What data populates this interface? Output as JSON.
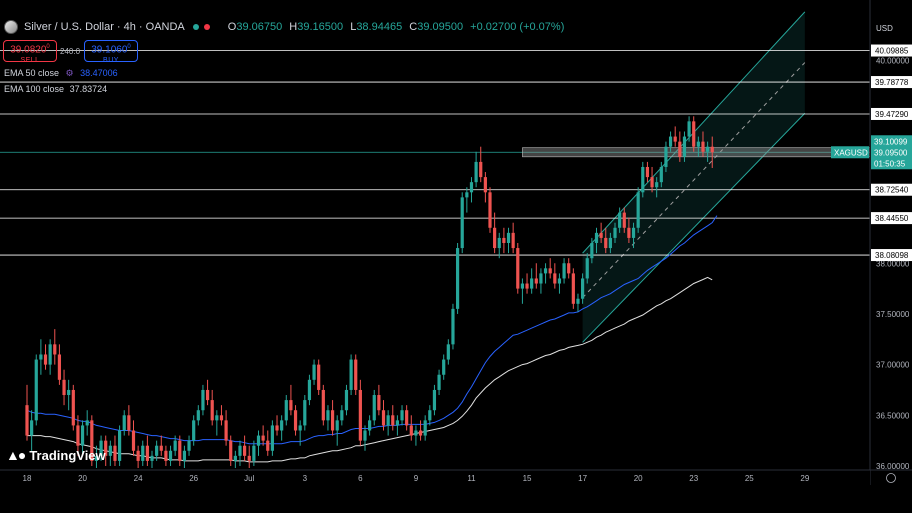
{
  "header": {
    "symbol": "Silver / U.S. Dollar · 4h · OANDA",
    "open_label": "O",
    "open": "39.06750",
    "high_label": "H",
    "high": "39.16500",
    "low_label": "L",
    "low": "38.94465",
    "close_label": "C",
    "close": "39.09500",
    "change": "+0.02700 (+0.07%)",
    "status_colors": [
      "#26a69a",
      "#f23645"
    ]
  },
  "trade": {
    "sell_price": "39.0820",
    "sell_sup": "0",
    "sell_label": "SELL",
    "spread": "240.0",
    "buy_price": "39.1060",
    "buy_sup": "0",
    "buy_label": "BUY"
  },
  "indicators": {
    "ema50_label": "EMA 50 close",
    "ema50_value": "38.47006",
    "ema50_color": "#2962ff",
    "ema100_label": "EMA 100 close",
    "ema100_value": "37.83724",
    "ema100_color": "#e0e0e0"
  },
  "currency": "USD",
  "logo": "TradingView",
  "chart_data": {
    "type": "candlestick",
    "symbol": "XAGUSD",
    "timeframe": "4h",
    "ylim": [
      35.98,
      40.4
    ],
    "y_ticks": [
      36.0,
      36.5,
      37.0,
      37.5,
      38.0,
      40.0
    ],
    "y_tick_labels": [
      "36.00000",
      "36.50000",
      "37.00000",
      "37.50000",
      "38.00000",
      "40.00000"
    ],
    "x_tick_labels": [
      "18",
      "20",
      "24",
      "26",
      "Jul",
      "3",
      "6",
      "9",
      "11",
      "15",
      "17",
      "20",
      "23",
      "25",
      "29"
    ],
    "x_tick_positions": [
      0,
      12,
      24,
      36,
      48,
      60,
      72,
      84,
      96,
      108,
      120,
      132,
      144,
      156,
      168
    ],
    "horizontal_levels": [
      {
        "price": 40.09885,
        "label": "40.09885"
      },
      {
        "price": 39.78778,
        "label": "39.78778"
      },
      {
        "price": 39.4729,
        "label": "39.47290"
      },
      {
        "price": 38.7254,
        "label": "38.72540"
      },
      {
        "price": 38.4455,
        "label": "38.44550"
      },
      {
        "price": 38.08098,
        "label": "38.08098"
      }
    ],
    "price_labels": [
      {
        "label": "39.10099",
        "price": 39.10099
      },
      {
        "label": "XAGUSD",
        "price": 39.095
      },
      {
        "label": "39.09500",
        "price": 39.095
      },
      {
        "label": "01:50:35",
        "price": 39.095
      }
    ],
    "current_price": 39.095,
    "resistance_zone": [
      39.05,
      39.14
    ],
    "channel": {
      "start_bar": 120,
      "end_bar": 168,
      "lower": [
        37.22,
        39.48
      ],
      "upper": [
        38.1,
        40.48
      ],
      "mid": [
        37.66,
        39.98
      ]
    },
    "colors": {
      "up": "#26a69a",
      "down": "#ef5350",
      "ema50": "#2962ff",
      "ema100": "#e0e0e0",
      "channel": "#26a69a"
    },
    "candles": [
      [
        36.6,
        36.8,
        36.25,
        36.3
      ],
      [
        36.3,
        36.55,
        36.15,
        36.45
      ],
      [
        36.45,
        37.1,
        36.4,
        37.05
      ],
      [
        37.05,
        37.25,
        36.9,
        37.1
      ],
      [
        37.1,
        37.2,
        36.95,
        37.0
      ],
      [
        37.0,
        37.25,
        36.9,
        37.2
      ],
      [
        37.2,
        37.35,
        37.0,
        37.1
      ],
      [
        37.1,
        37.2,
        36.8,
        36.85
      ],
      [
        36.85,
        36.95,
        36.6,
        36.7
      ],
      [
        36.7,
        36.85,
        36.55,
        36.75
      ],
      [
        36.75,
        36.8,
        36.35,
        36.4
      ],
      [
        36.4,
        36.5,
        36.1,
        36.2
      ],
      [
        36.2,
        36.45,
        36.1,
        36.4
      ],
      [
        36.4,
        36.55,
        36.3,
        36.45
      ],
      [
        36.45,
        36.5,
        36.0,
        36.05
      ],
      [
        36.05,
        36.2,
        35.98,
        36.1
      ],
      [
        36.1,
        36.3,
        36.05,
        36.25
      ],
      [
        36.25,
        36.3,
        36.0,
        36.1
      ],
      [
        36.1,
        36.25,
        36.0,
        36.2
      ],
      [
        36.2,
        36.3,
        36.0,
        36.05
      ],
      [
        36.05,
        36.4,
        36.0,
        36.35
      ],
      [
        36.35,
        36.55,
        36.3,
        36.5
      ],
      [
        36.5,
        36.6,
        36.3,
        36.35
      ],
      [
        36.35,
        36.45,
        36.1,
        36.15
      ],
      [
        36.15,
        36.2,
        35.98,
        36.05
      ],
      [
        36.05,
        36.25,
        36.0,
        36.2
      ],
      [
        36.2,
        36.3,
        36.0,
        36.05
      ],
      [
        36.05,
        36.15,
        35.98,
        36.1
      ],
      [
        36.1,
        36.25,
        36.05,
        36.2
      ],
      [
        36.2,
        36.3,
        36.1,
        36.15
      ],
      [
        36.15,
        36.2,
        36.0,
        36.05
      ],
      [
        36.05,
        36.2,
        36.0,
        36.15
      ],
      [
        36.15,
        36.3,
        36.1,
        36.25
      ],
      [
        36.25,
        36.3,
        36.0,
        36.05
      ],
      [
        36.05,
        36.2,
        35.98,
        36.15
      ],
      [
        36.15,
        36.3,
        36.1,
        36.25
      ],
      [
        36.25,
        36.5,
        36.2,
        36.45
      ],
      [
        36.45,
        36.6,
        36.4,
        36.55
      ],
      [
        36.55,
        36.8,
        36.5,
        36.75
      ],
      [
        36.75,
        36.85,
        36.6,
        36.65
      ],
      [
        36.65,
        36.75,
        36.4,
        36.45
      ],
      [
        36.45,
        36.55,
        36.3,
        36.5
      ],
      [
        36.5,
        36.6,
        36.4,
        36.45
      ],
      [
        36.45,
        36.55,
        36.2,
        36.25
      ],
      [
        36.25,
        36.3,
        36.0,
        36.05
      ],
      [
        36.05,
        36.15,
        35.98,
        36.1
      ],
      [
        36.1,
        36.25,
        36.0,
        36.2
      ],
      [
        36.2,
        36.3,
        36.05,
        36.1
      ],
      [
        36.1,
        36.2,
        35.98,
        36.05
      ],
      [
        36.05,
        36.25,
        36.0,
        36.2
      ],
      [
        36.2,
        36.35,
        36.1,
        36.3
      ],
      [
        36.3,
        36.4,
        36.2,
        36.25
      ],
      [
        36.25,
        36.35,
        36.1,
        36.15
      ],
      [
        36.15,
        36.45,
        36.1,
        36.4
      ],
      [
        36.4,
        36.5,
        36.3,
        36.35
      ],
      [
        36.35,
        36.5,
        36.25,
        36.45
      ],
      [
        36.45,
        36.7,
        36.4,
        36.65
      ],
      [
        36.65,
        36.8,
        36.5,
        36.55
      ],
      [
        36.55,
        36.6,
        36.3,
        36.35
      ],
      [
        36.35,
        36.45,
        36.2,
        36.4
      ],
      [
        36.4,
        36.7,
        36.35,
        36.65
      ],
      [
        36.65,
        36.9,
        36.6,
        36.85
      ],
      [
        36.85,
        37.05,
        36.8,
        37.0
      ],
      [
        37.0,
        37.05,
        36.7,
        36.75
      ],
      [
        36.75,
        36.8,
        36.4,
        36.45
      ],
      [
        36.45,
        36.6,
        36.35,
        36.55
      ],
      [
        36.55,
        36.65,
        36.3,
        36.35
      ],
      [
        36.35,
        36.5,
        36.2,
        36.45
      ],
      [
        36.45,
        36.6,
        36.4,
        36.55
      ],
      [
        36.55,
        36.8,
        36.5,
        36.75
      ],
      [
        36.75,
        37.1,
        36.7,
        37.05
      ],
      [
        37.05,
        37.1,
        36.7,
        36.75
      ],
      [
        36.75,
        36.85,
        36.2,
        36.25
      ],
      [
        36.25,
        36.4,
        36.15,
        36.35
      ],
      [
        36.35,
        36.5,
        36.3,
        36.45
      ],
      [
        36.45,
        36.75,
        36.4,
        36.7
      ],
      [
        36.7,
        36.8,
        36.5,
        36.55
      ],
      [
        36.55,
        36.65,
        36.35,
        36.4
      ],
      [
        36.4,
        36.55,
        36.3,
        36.5
      ],
      [
        36.5,
        36.6,
        36.35,
        36.4
      ],
      [
        36.4,
        36.5,
        36.3,
        36.45
      ],
      [
        36.45,
        36.6,
        36.4,
        36.55
      ],
      [
        36.55,
        36.6,
        36.35,
        36.4
      ],
      [
        36.4,
        36.5,
        36.25,
        36.3
      ],
      [
        36.3,
        36.4,
        36.2,
        36.35
      ],
      [
        36.35,
        36.45,
        36.25,
        36.3
      ],
      [
        36.3,
        36.5,
        36.25,
        36.45
      ],
      [
        36.45,
        36.6,
        36.4,
        36.55
      ],
      [
        36.55,
        36.8,
        36.5,
        36.75
      ],
      [
        36.75,
        36.95,
        36.7,
        36.9
      ],
      [
        36.9,
        37.1,
        36.85,
        37.05
      ],
      [
        37.05,
        37.25,
        37.0,
        37.2
      ],
      [
        37.2,
        37.6,
        37.15,
        37.55
      ],
      [
        37.55,
        38.2,
        37.5,
        38.15
      ],
      [
        38.15,
        38.7,
        38.1,
        38.65
      ],
      [
        38.65,
        38.75,
        38.5,
        38.7
      ],
      [
        38.7,
        38.85,
        38.6,
        38.8
      ],
      [
        38.8,
        39.1,
        38.75,
        39.0
      ],
      [
        39.0,
        39.15,
        38.8,
        38.85
      ],
      [
        38.85,
        38.9,
        38.6,
        38.7
      ],
      [
        38.7,
        38.75,
        38.3,
        38.35
      ],
      [
        38.35,
        38.5,
        38.1,
        38.15
      ],
      [
        38.15,
        38.3,
        38.05,
        38.25
      ],
      [
        38.25,
        38.35,
        38.1,
        38.2
      ],
      [
        38.2,
        38.35,
        38.1,
        38.3
      ],
      [
        38.3,
        38.4,
        38.1,
        38.15
      ],
      [
        38.15,
        38.2,
        37.7,
        37.75
      ],
      [
        37.75,
        37.85,
        37.6,
        37.8
      ],
      [
        37.8,
        37.9,
        37.7,
        37.75
      ],
      [
        37.75,
        37.95,
        37.7,
        37.85
      ],
      [
        37.85,
        38.0,
        37.75,
        37.8
      ],
      [
        37.8,
        37.95,
        37.7,
        37.9
      ],
      [
        37.9,
        38.0,
        37.8,
        37.95
      ],
      [
        37.95,
        38.05,
        37.85,
        37.9
      ],
      [
        37.9,
        38.0,
        37.75,
        37.8
      ],
      [
        37.8,
        37.9,
        37.7,
        37.85
      ],
      [
        37.85,
        38.05,
        37.8,
        38.0
      ],
      [
        38.0,
        38.05,
        37.85,
        37.9
      ],
      [
        37.9,
        37.95,
        37.55,
        37.6
      ],
      [
        37.6,
        37.7,
        37.52,
        37.65
      ],
      [
        37.65,
        37.9,
        37.6,
        37.85
      ],
      [
        37.85,
        38.1,
        37.8,
        38.05
      ],
      [
        38.05,
        38.25,
        38.0,
        38.2
      ],
      [
        38.2,
        38.35,
        38.1,
        38.3
      ],
      [
        38.3,
        38.4,
        38.2,
        38.25
      ],
      [
        38.25,
        38.35,
        38.1,
        38.15
      ],
      [
        38.15,
        38.3,
        38.1,
        38.25
      ],
      [
        38.25,
        38.4,
        38.2,
        38.35
      ],
      [
        38.35,
        38.55,
        38.3,
        38.5
      ],
      [
        38.5,
        38.55,
        38.3,
        38.35
      ],
      [
        38.35,
        38.45,
        38.2,
        38.25
      ],
      [
        38.25,
        38.4,
        38.15,
        38.35
      ],
      [
        38.35,
        38.75,
        38.3,
        38.7
      ],
      [
        38.7,
        39.0,
        38.65,
        38.95
      ],
      [
        38.95,
        39.0,
        38.8,
        38.85
      ],
      [
        38.85,
        38.95,
        38.7,
        38.75
      ],
      [
        38.75,
        38.85,
        38.65,
        38.8
      ],
      [
        38.8,
        39.0,
        38.75,
        38.95
      ],
      [
        38.95,
        39.2,
        38.9,
        39.15
      ],
      [
        39.15,
        39.3,
        39.1,
        39.25
      ],
      [
        39.25,
        39.35,
        39.15,
        39.2
      ],
      [
        39.2,
        39.3,
        39.0,
        39.05
      ],
      [
        39.05,
        39.3,
        39.0,
        39.25
      ],
      [
        39.25,
        39.45,
        39.2,
        39.4
      ],
      [
        39.4,
        39.45,
        39.1,
        39.15
      ],
      [
        39.15,
        39.25,
        39.05,
        39.2
      ],
      [
        39.2,
        39.3,
        39.05,
        39.1
      ],
      [
        39.1,
        39.2,
        39.0,
        39.15
      ],
      [
        39.15,
        39.25,
        38.94,
        39.095
      ]
    ],
    "ema50": [
      36.55,
      36.53,
      36.52,
      36.52,
      36.51,
      36.51,
      36.51,
      36.5,
      36.49,
      36.48,
      36.47,
      36.45,
      36.44,
      36.44,
      36.42,
      36.4,
      36.39,
      36.38,
      36.37,
      36.36,
      36.35,
      36.35,
      36.35,
      36.34,
      36.33,
      36.32,
      36.31,
      36.3,
      36.3,
      36.29,
      36.28,
      36.27,
      36.27,
      36.26,
      36.25,
      36.25,
      36.25,
      36.25,
      36.26,
      36.26,
      36.26,
      36.26,
      36.26,
      36.26,
      36.25,
      36.24,
      36.24,
      36.23,
      36.22,
      36.22,
      36.22,
      36.22,
      36.22,
      36.22,
      36.22,
      36.22,
      36.23,
      36.24,
      36.24,
      36.24,
      36.25,
      36.27,
      36.29,
      36.3,
      36.3,
      36.31,
      36.31,
      36.32,
      36.32,
      36.34,
      36.36,
      36.37,
      36.37,
      36.37,
      36.37,
      36.38,
      36.39,
      36.39,
      36.4,
      36.4,
      36.4,
      36.41,
      36.41,
      36.41,
      36.41,
      36.41,
      36.41,
      36.42,
      36.43,
      36.45,
      36.47,
      36.5,
      36.53,
      36.57,
      36.63,
      36.71,
      36.78,
      36.86,
      36.94,
      37.02,
      37.08,
      37.13,
      37.17,
      37.21,
      37.25,
      37.29,
      37.3,
      37.32,
      37.34,
      37.36,
      37.38,
      37.4,
      37.42,
      37.44,
      37.45,
      37.47,
      37.49,
      37.51,
      37.51,
      37.52,
      37.55,
      37.57,
      37.6,
      37.63,
      37.66,
      37.68,
      37.7,
      37.73,
      37.76,
      37.79,
      37.81,
      37.83,
      37.85,
      37.89,
      37.93,
      37.96,
      37.99,
      38.02,
      38.05,
      38.09,
      38.13,
      38.17,
      38.2,
      38.24,
      38.28,
      38.31,
      38.34,
      38.37,
      38.4,
      38.47006
    ],
    "ema100": [
      36.3,
      36.3,
      36.3,
      36.3,
      36.29,
      36.29,
      36.28,
      36.27,
      36.26,
      36.25,
      36.24,
      36.22,
      36.21,
      36.2,
      36.19,
      36.17,
      36.16,
      36.15,
      36.14,
      36.13,
      36.12,
      36.12,
      36.12,
      36.11,
      36.1,
      36.1,
      36.09,
      36.08,
      36.08,
      36.08,
      36.07,
      36.06,
      36.06,
      36.06,
      36.05,
      36.05,
      36.05,
      36.05,
      36.06,
      36.06,
      36.06,
      36.06,
      36.06,
      36.06,
      36.06,
      36.05,
      36.05,
      36.05,
      36.04,
      36.04,
      36.04,
      36.04,
      36.04,
      36.05,
      36.05,
      36.05,
      36.06,
      36.07,
      36.07,
      36.08,
      36.08,
      36.1,
      36.11,
      36.12,
      36.13,
      36.14,
      36.15,
      36.15,
      36.16,
      36.17,
      36.18,
      36.2,
      36.2,
      36.21,
      36.22,
      36.23,
      36.24,
      36.25,
      36.26,
      36.27,
      36.28,
      36.29,
      36.3,
      36.31,
      36.32,
      36.33,
      36.34,
      36.35,
      36.36,
      36.37,
      36.38,
      36.4,
      36.42,
      36.45,
      36.49,
      36.54,
      36.6,
      36.67,
      36.72,
      36.77,
      36.81,
      36.85,
      36.88,
      36.91,
      36.94,
      36.96,
      36.98,
      37.0,
      37.01,
      37.03,
      37.05,
      37.07,
      37.09,
      37.1,
      37.12,
      37.14,
      37.15,
      37.17,
      37.18,
      37.19,
      37.2,
      37.22,
      37.24,
      37.27,
      37.29,
      37.32,
      37.34,
      37.36,
      37.38,
      37.4,
      37.43,
      37.45,
      37.47,
      37.49,
      37.52,
      37.55,
      37.58,
      37.6,
      37.63,
      37.65,
      37.68,
      37.71,
      37.74,
      37.77,
      37.8,
      37.82,
      37.84,
      37.86,
      37.83724
    ]
  }
}
